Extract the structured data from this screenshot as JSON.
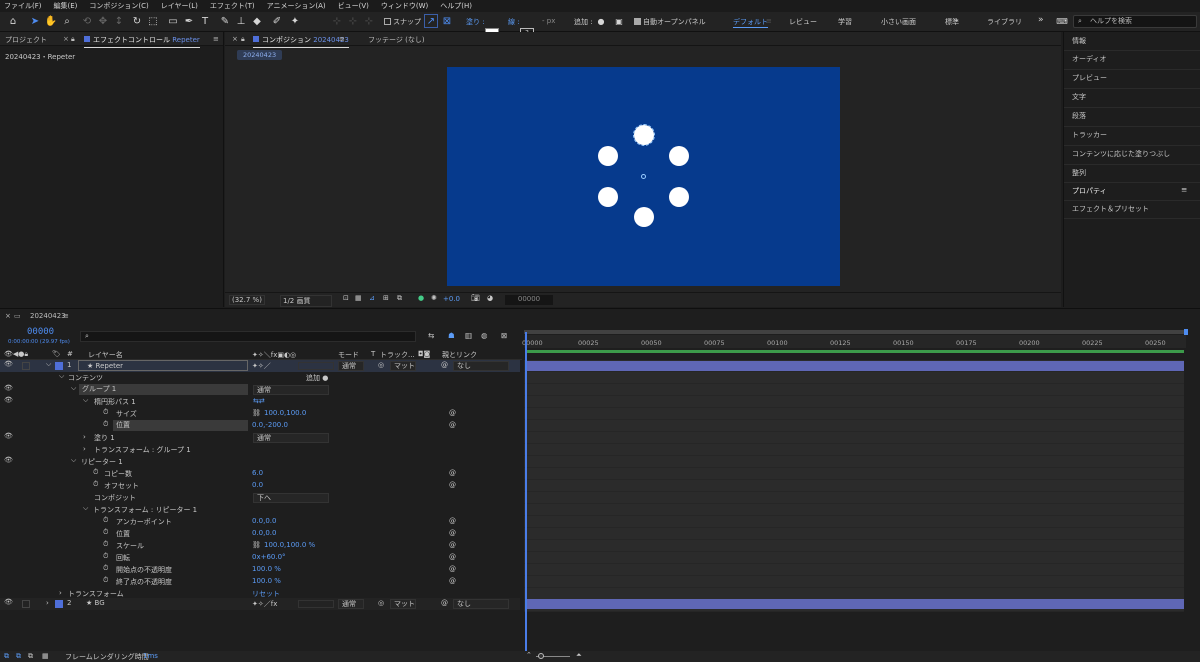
{
  "menu": [
    "ファイル(F)",
    "編集(E)",
    "コンポジション(C)",
    "レイヤー(L)",
    "エフェクト(T)",
    "アニメーション(A)",
    "ビュー(V)",
    "ウィンドウ(W)",
    "ヘルプ(H)"
  ],
  "toolbar": {
    "snap": "スナップ",
    "fill": "塗り :",
    "stroke": "線 :",
    "stroke_value": "?",
    "px": "- px",
    "add": "追加 :",
    "auto_open": "自動オープンパネル",
    "workspaces": [
      "デフォルト",
      "レビュー",
      "学習",
      "小さい画面",
      "標準",
      "ライブラリ"
    ],
    "help_placeholder": "ヘルプを検索"
  },
  "left_panel": {
    "tab_project": "プロジェクト",
    "tab_effect": "エフェクトコントロール",
    "tab_effect_target": "Repeter",
    "info": "20240423・Repeter"
  },
  "comp": {
    "tab_label": "コンポジション",
    "tab_name": "20240423",
    "footage_tab": "フッテージ (なし)",
    "sub_tab": "20240423",
    "zoom": "(32.7 %)",
    "quality": "1/2 画質",
    "exposure": "+0.0",
    "timecode": "00000"
  },
  "right_panel": {
    "items": [
      "情報",
      "オーディオ",
      "プレビュー",
      "文字",
      "段落",
      "トラッカー",
      "コンテンツに応じた塗りつぶし",
      "整列",
      "プロパティ",
      "エフェクト＆プリセット"
    ]
  },
  "timeline": {
    "comp_name": "20240423",
    "timecode": "00000",
    "fps": "0:00:00:00 (29.97 fps)",
    "headers": {
      "layer_name": "レイヤー名",
      "mode": "モード",
      "track": "T",
      "track_matte": "トラック...",
      "parent": "親とリンク"
    },
    "ticks": [
      "00000",
      "00025",
      "00050",
      "00075",
      "00100",
      "00125",
      "00150",
      "00175",
      "00200",
      "00225",
      "00250"
    ],
    "layer1": {
      "num": "1",
      "name": "Repeter",
      "mode": "通常",
      "matte": "マット",
      "parent": "なし"
    },
    "contents": "コンテンツ",
    "add_label": "追加",
    "group": "グループ 1",
    "group_mode": "通常",
    "ellipse": "楕円形パス 1",
    "size": "サイズ",
    "size_value": "100.0,100.0",
    "position": "位置",
    "position_value": "0.0,-200.0",
    "fill": "塗り 1",
    "fill_mode": "通常",
    "transform_group": "トランスフォーム : グループ 1",
    "repeater": "リピーター 1",
    "copies": "コピー数",
    "copies_value": "6.0",
    "offset": "オフセット",
    "offset_value": "0.0",
    "composite": "コンポジット",
    "composite_value": "下へ",
    "transform_repeater": "トランスフォーム : リピーター 1",
    "anchor": "アンカーポイント",
    "anchor_value": "0.0,0.0",
    "rep_position": "位置",
    "rep_position_value": "0.0,0.0",
    "scale": "スケール",
    "scale_value": "100.0,100.0 %",
    "rotation": "回転",
    "rotation_value": "0x+60.0°",
    "start_opacity": "開始点の不透明度",
    "start_opacity_value": "100.0 %",
    "end_opacity": "終了点の不透明度",
    "end_opacity_value": "100.0 %",
    "transform": "トランスフォーム",
    "reset": "リセット",
    "layer2": {
      "num": "2",
      "name": "BG",
      "mode": "通常",
      "matte": "マット",
      "parent": "なし"
    },
    "status_label": "フレームレンダリング時間",
    "status_value": "1ms"
  },
  "colors": {
    "accent": "#4e8cf0",
    "comp_bg": "#063a8d",
    "layer_bar": "#5f67b5"
  }
}
